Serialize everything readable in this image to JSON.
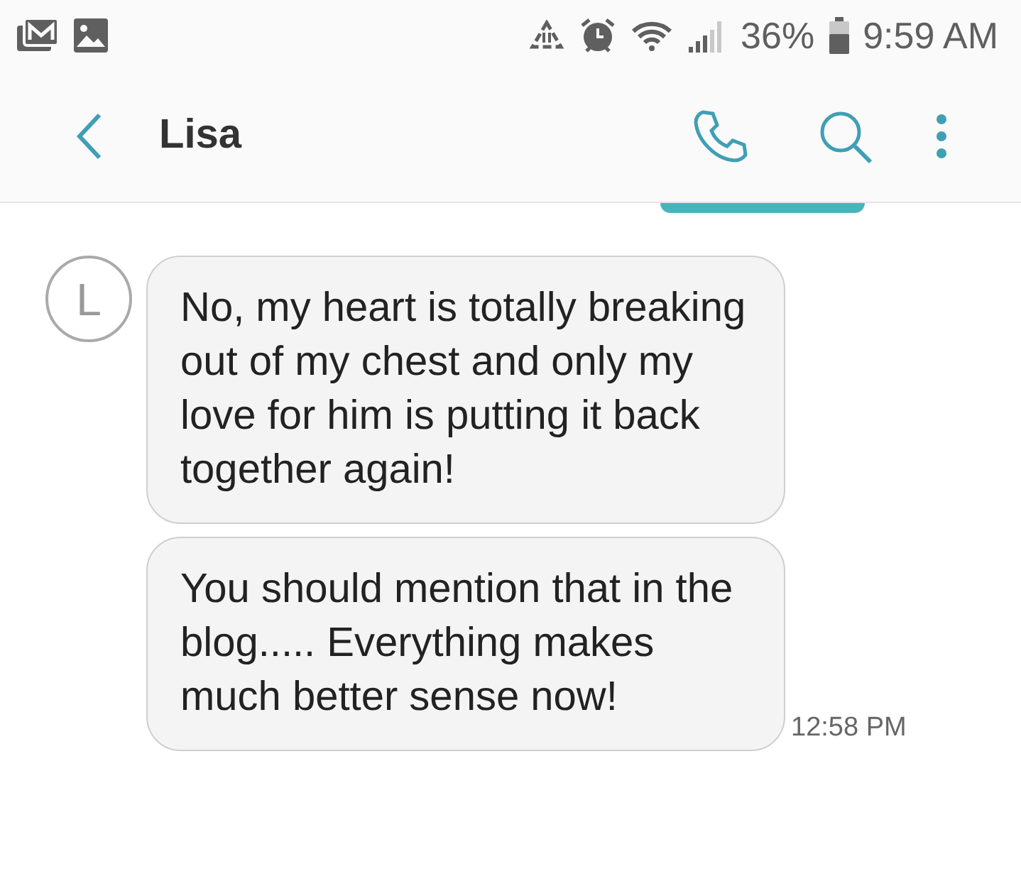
{
  "status_bar": {
    "battery": "36%",
    "time": "9:59 AM"
  },
  "header": {
    "title": "Lisa"
  },
  "avatar": {
    "letter": "L"
  },
  "messages": [
    {
      "text": "No, my heart is totally breaking out of my chest and only my love for him is putting it back together again!"
    },
    {
      "text": "You should mention that in the blog..... Everything makes much better sense now!",
      "time": "12:58 PM"
    }
  ]
}
